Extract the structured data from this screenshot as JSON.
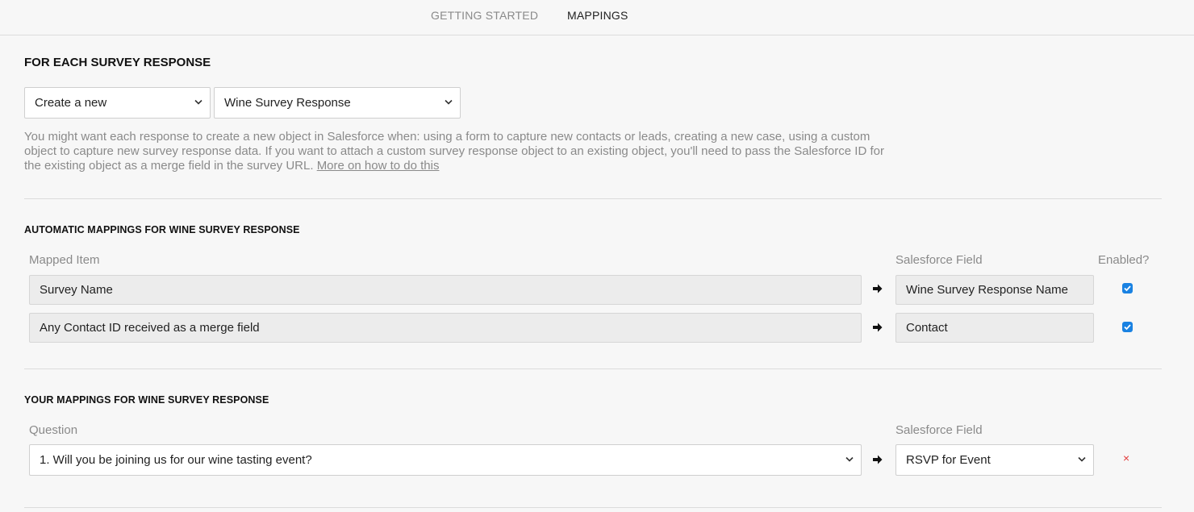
{
  "nav": {
    "tabs": [
      {
        "label": "GETTING STARTED",
        "active": false
      },
      {
        "label": "MAPPINGS",
        "active": true
      }
    ]
  },
  "survey_response": {
    "heading": "FOR EACH SURVEY RESPONSE",
    "action_select": "Create a new",
    "object_select": "Wine Survey Response",
    "help_text": "You might want each response to create a new object in Salesforce when: using a form to capture new contacts or leads, creating a new case, using a custom object to capture new survey response data. If you want to attach a custom survey response object to an existing object, you'll need to pass the Salesforce ID for the existing object as a merge field in the survey URL.",
    "help_link": "More on how to do this"
  },
  "automatic": {
    "heading": "AUTOMATIC MAPPINGS FOR WINE SURVEY RESPONSE",
    "col_mapped": "Mapped Item",
    "col_field": "Salesforce Field",
    "col_enabled": "Enabled?",
    "rows": [
      {
        "item": "Survey Name",
        "field": "Wine Survey Response Name",
        "enabled": true
      },
      {
        "item": "Any Contact ID received as a merge field",
        "field": "Contact",
        "enabled": true
      }
    ]
  },
  "yours": {
    "heading": "YOUR MAPPINGS FOR WINE SURVEY RESPONSE",
    "col_question": "Question",
    "col_field": "Salesforce Field",
    "rows": [
      {
        "question": "1. Will you be joining us for our wine tasting event?",
        "field": "RSVP for Event",
        "remove": "×"
      }
    ]
  },
  "colors": {
    "accent": "#1a82e2",
    "remove": "#e23b3b",
    "muted_text": "#8a8a8a"
  }
}
